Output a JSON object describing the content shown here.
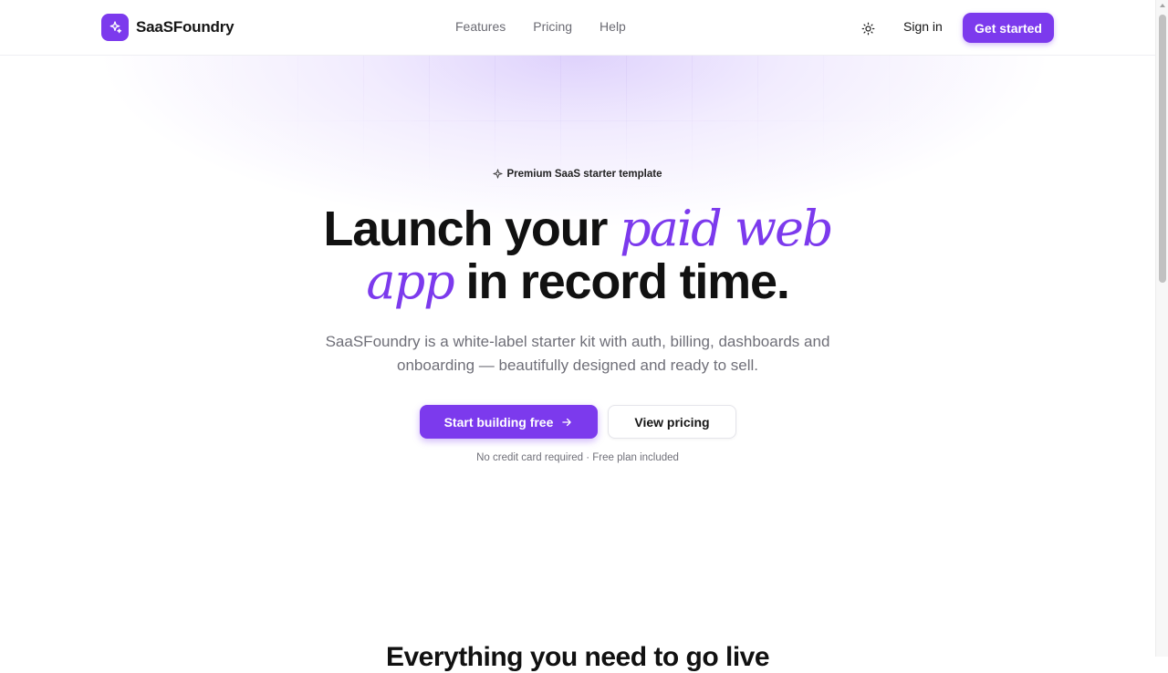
{
  "brand": {
    "name": "SaaSFoundry",
    "logo_icon": "sparkles-icon",
    "accent": "#7c3aed"
  },
  "nav": {
    "items": [
      {
        "label": "Features"
      },
      {
        "label": "Pricing"
      },
      {
        "label": "Help"
      }
    ]
  },
  "header": {
    "theme_icon": "sun-icon",
    "signin_label": "Sign in",
    "cta_label": "Get started"
  },
  "hero": {
    "badge_icon": "sparkle-icon",
    "badge_text": "Premium SaaS starter template",
    "title_part1": "Launch your ",
    "title_accent1": "paid web",
    "title_accent2": "app",
    "title_part2": " in record time.",
    "subtitle": "SaaSFoundry is a white-label starter kit with auth, billing, dashboards and onboarding — beautifully designed and ready to sell.",
    "primary_cta": "Start building free",
    "primary_cta_icon": "arrow-right-icon",
    "secondary_cta": "View pricing",
    "note": "No credit card required · Free plan included"
  },
  "features": {
    "heading": "Everything you need to go live"
  }
}
